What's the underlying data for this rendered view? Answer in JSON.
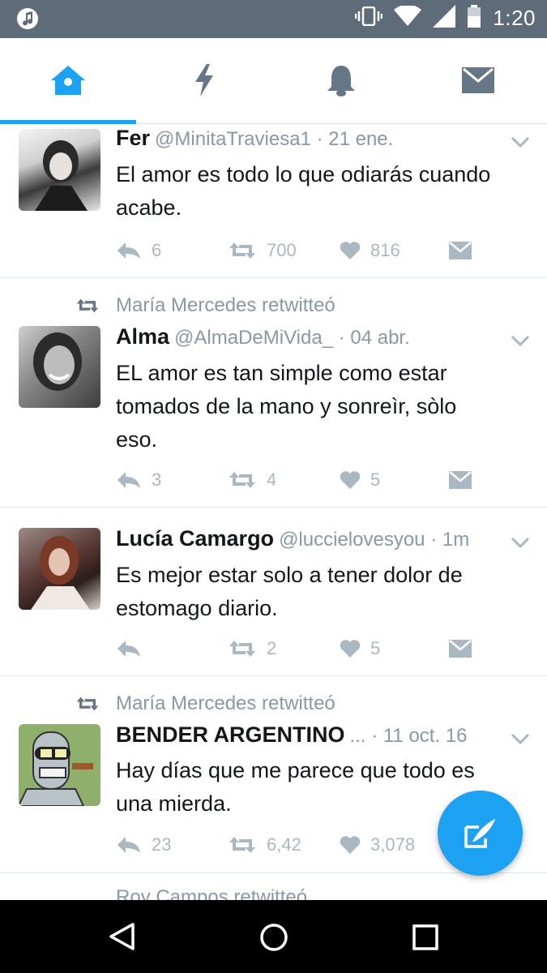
{
  "status_bar": {
    "time": "1:20",
    "icons": [
      "music-icon",
      "vibrate-icon",
      "wifi-icon",
      "signal-icon",
      "battery-icon"
    ]
  },
  "tabs": [
    {
      "icon": "home-icon",
      "active": true
    },
    {
      "icon": "lightning-icon",
      "active": false
    },
    {
      "icon": "bell-icon",
      "active": false
    },
    {
      "icon": "mail-icon",
      "active": false
    }
  ],
  "colors": {
    "accent": "#1da1f2",
    "muted": "#8899a6",
    "text": "#14171a",
    "status_bar": "#5e6b78"
  },
  "tweets": [
    {
      "retweeted_by": "",
      "name": "Fer",
      "handle": "@MinitaTraviesa1",
      "date": "· 21 ene.",
      "text_lines": [
        "El amor es todo lo que odiarás cuando",
        "acabe."
      ],
      "replies": "6",
      "retweets": "700",
      "likes": "816"
    },
    {
      "retweeted_by": "María Mercedes retwitteó",
      "name": "Alma",
      "handle": "@AlmaDeMiVida_",
      "date": "· 04 abr.",
      "text_lines": [
        "EL amor es tan simple como estar",
        "tomados de la mano y sonreìr, sòlo",
        "eso."
      ],
      "replies": "3",
      "retweets": "4",
      "likes": "5"
    },
    {
      "retweeted_by": "",
      "name": "Lucía Camargo",
      "handle": "@luccielovesyou",
      "date": "· 1m",
      "text_lines": [
        "Es mejor estar solo a tener dolor de",
        "estomago diario."
      ],
      "replies": "",
      "retweets": "2",
      "likes": "5"
    },
    {
      "retweeted_by": "María Mercedes retwitteó",
      "name": "BENDER ARGENTINO",
      "handle": "...",
      "date": "· 11 oct. 16",
      "text_lines": [
        "Hay días que me parece que todo es",
        "una mierda."
      ],
      "replies": "23",
      "retweets": "6,42",
      "likes": "3,078"
    }
  ],
  "partial_next": "Roy Campos retwitteó",
  "fab": {
    "icon": "compose-tweet-icon"
  },
  "navbar": {
    "icons": [
      "back-icon",
      "home-circle-icon",
      "recents-icon"
    ]
  }
}
